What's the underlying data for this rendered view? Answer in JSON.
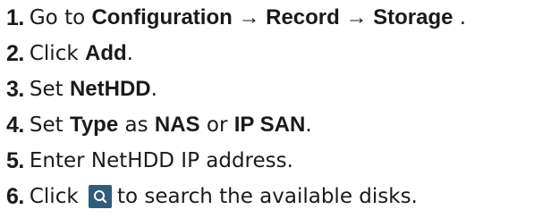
{
  "steps": [
    {
      "number": "1.",
      "parts": [
        {
          "text": "Go to ",
          "bold": false
        },
        {
          "text": "Configuration → Record → Storage",
          "bold": true
        },
        {
          "text": " .",
          "bold": false
        }
      ]
    },
    {
      "number": "2.",
      "parts": [
        {
          "text": "Click ",
          "bold": false
        },
        {
          "text": "Add",
          "bold": true
        },
        {
          "text": ".",
          "bold": false
        }
      ]
    },
    {
      "number": "3.",
      "parts": [
        {
          "text": "Set ",
          "bold": false
        },
        {
          "text": "NetHDD",
          "bold": true
        },
        {
          "text": ".",
          "bold": false
        }
      ]
    },
    {
      "number": "4.",
      "parts": [
        {
          "text": "Set ",
          "bold": false
        },
        {
          "text": "Type",
          "bold": true
        },
        {
          "text": " as ",
          "bold": false
        },
        {
          "text": "NAS",
          "bold": true
        },
        {
          "text": " or ",
          "bold": false
        },
        {
          "text": "IP SAN",
          "bold": true
        },
        {
          "text": ".",
          "bold": false
        }
      ]
    },
    {
      "number": "5.",
      "parts": [
        {
          "text": "Enter NetHDD IP address.",
          "bold": false
        }
      ]
    },
    {
      "number": "6.",
      "parts": [
        {
          "text": "Click ",
          "bold": false
        },
        {
          "icon": "search-icon"
        },
        {
          "text": "to search the available disks.",
          "bold": false
        }
      ]
    }
  ],
  "icon_color": "#2f5d7d"
}
